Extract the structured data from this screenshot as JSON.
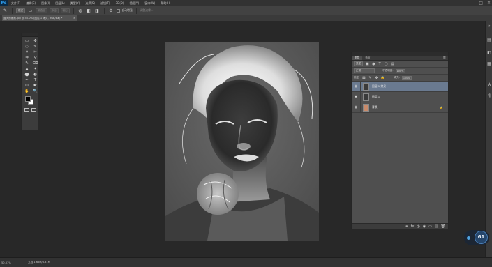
{
  "app": {
    "logo": "Ps"
  },
  "menu": [
    "文件(F)",
    "编辑(E)",
    "图像(I)",
    "图层(L)",
    "类型(Y)",
    "选择(S)",
    "滤镜(T)",
    "3D(D)",
    "视图(V)",
    "窗口(W)",
    "帮助(H)"
  ],
  "window_controls": [
    "–",
    "□",
    "✕"
  ],
  "options_bar": {
    "mode_field": "模式",
    "fields": [
      "新选区",
      "添加",
      "羽化",
      "调整边缘"
    ],
    "auto_enhance_label": "自动增强",
    "refine_edge_label": "调整边缘..."
  },
  "document": {
    "tab_label": "蓝天的素颜.jpg @ 50.0% (图层 1 拷贝, RGB/8#) *",
    "close": "×"
  },
  "tools_panel": {
    "tools": [
      "▭",
      "✥",
      "◌",
      "✎",
      "⌗",
      "✂",
      "✚",
      "⚲",
      "✎",
      "⌫",
      "▲",
      "✦",
      "⬤",
      "◐",
      "✒",
      "T",
      "⬭",
      "☛",
      "✋",
      "🔍"
    ]
  },
  "layers_panel": {
    "tabs": [
      "图层",
      "通道"
    ],
    "filter_label": "类型",
    "blend_mode": "正常",
    "opacity_label": "不透明度:",
    "opacity_value": "100%",
    "lock_label": "锁定:",
    "fill_label": "填充:",
    "fill_value": "100%",
    "layers": [
      {
        "name": "图层 1 拷贝",
        "selected": true
      },
      {
        "name": "图层 1",
        "selected": false
      },
      {
        "name": "背景",
        "selected": false,
        "locked": true
      }
    ],
    "footer_icons": [
      "⚭",
      "fx",
      "◑",
      "◉",
      "▭",
      "▤",
      "🗑"
    ]
  },
  "status_bar": {
    "zoom": "50.01%",
    "doc_info": "文档:1.65M/6.31M"
  },
  "badge": {
    "value": "61",
    "unit": "%"
  }
}
